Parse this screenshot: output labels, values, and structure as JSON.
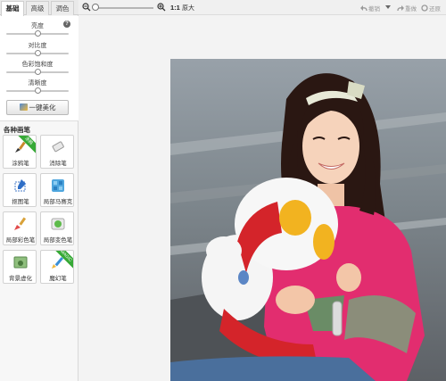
{
  "tabs": [
    {
      "label": "基础",
      "active": true
    },
    {
      "label": "高级",
      "active": false
    },
    {
      "label": "调色",
      "active": false
    }
  ],
  "adjust": {
    "sliders": [
      {
        "label": "亮度",
        "value": 0.5
      },
      {
        "label": "对比度",
        "value": 0.5
      },
      {
        "label": "色彩饱和度",
        "value": 0.5
      },
      {
        "label": "清晰度",
        "value": 0.5
      }
    ],
    "help_icon": "?",
    "auto_beautify_label": "一键美化"
  },
  "brushes": {
    "title": "各种画笔",
    "items": [
      {
        "label": "涂鸦笔",
        "icon": "paintbrush-icon",
        "badge": "涂鸦"
      },
      {
        "label": "消除笔",
        "icon": "eraser-icon",
        "badge": ""
      },
      {
        "label": "抠图笔",
        "icon": "cutout-pen-icon",
        "badge": ""
      },
      {
        "label": "局部马赛克",
        "icon": "mosaic-icon",
        "badge": ""
      },
      {
        "label": "局部彩色笔",
        "icon": "color-brush-icon",
        "badge": ""
      },
      {
        "label": "局部变色笔",
        "icon": "recolor-brush-icon",
        "badge": ""
      },
      {
        "label": "背景虚化",
        "icon": "bg-blur-icon",
        "badge": ""
      },
      {
        "label": "魔幻笔",
        "icon": "magic-pen-icon",
        "badge": "MAGIC"
      }
    ]
  },
  "toolbar": {
    "zoom_level": 0.05,
    "ratio_label": "1:1",
    "original_label": "原大",
    "undo_label": "撤销",
    "redo_label": "重做",
    "reset_label": "还原"
  },
  "colors": {
    "accent_green": "#36a936",
    "shirt_pink": "#e22d6f",
    "toy_red": "#d4242a"
  }
}
